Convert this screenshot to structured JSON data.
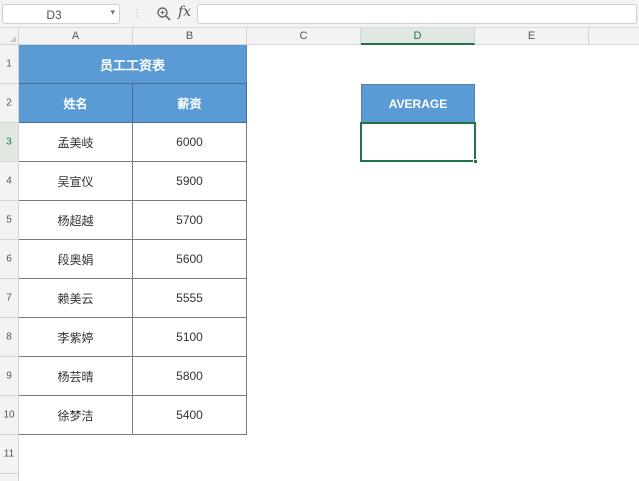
{
  "formula_bar": {
    "name_box": "D3",
    "fx_label": "fx",
    "formula": ""
  },
  "column_headers": [
    "A",
    "B",
    "C",
    "D",
    "E"
  ],
  "row_headers": [
    "1",
    "2",
    "3",
    "4",
    "5",
    "6",
    "7",
    "8",
    "9",
    "10",
    "11"
  ],
  "table": {
    "title": "员工工资表",
    "headers": [
      "姓名",
      "薪资"
    ],
    "rows": [
      {
        "name": "孟美岐",
        "salary": "6000"
      },
      {
        "name": "吴宣仪",
        "salary": "5900"
      },
      {
        "name": "杨超越",
        "salary": "5700"
      },
      {
        "name": "段奥娟",
        "salary": "5600"
      },
      {
        "name": "赖美云",
        "salary": "5555"
      },
      {
        "name": "李紫婷",
        "salary": "5100"
      },
      {
        "name": "杨芸晴",
        "salary": "5800"
      },
      {
        "name": "徐梦洁",
        "salary": "5400"
      }
    ]
  },
  "average_box": {
    "header": "AVERAGE",
    "value": ""
  },
  "colors": {
    "header_fill": "#5b9bd5",
    "selection": "#217346"
  }
}
